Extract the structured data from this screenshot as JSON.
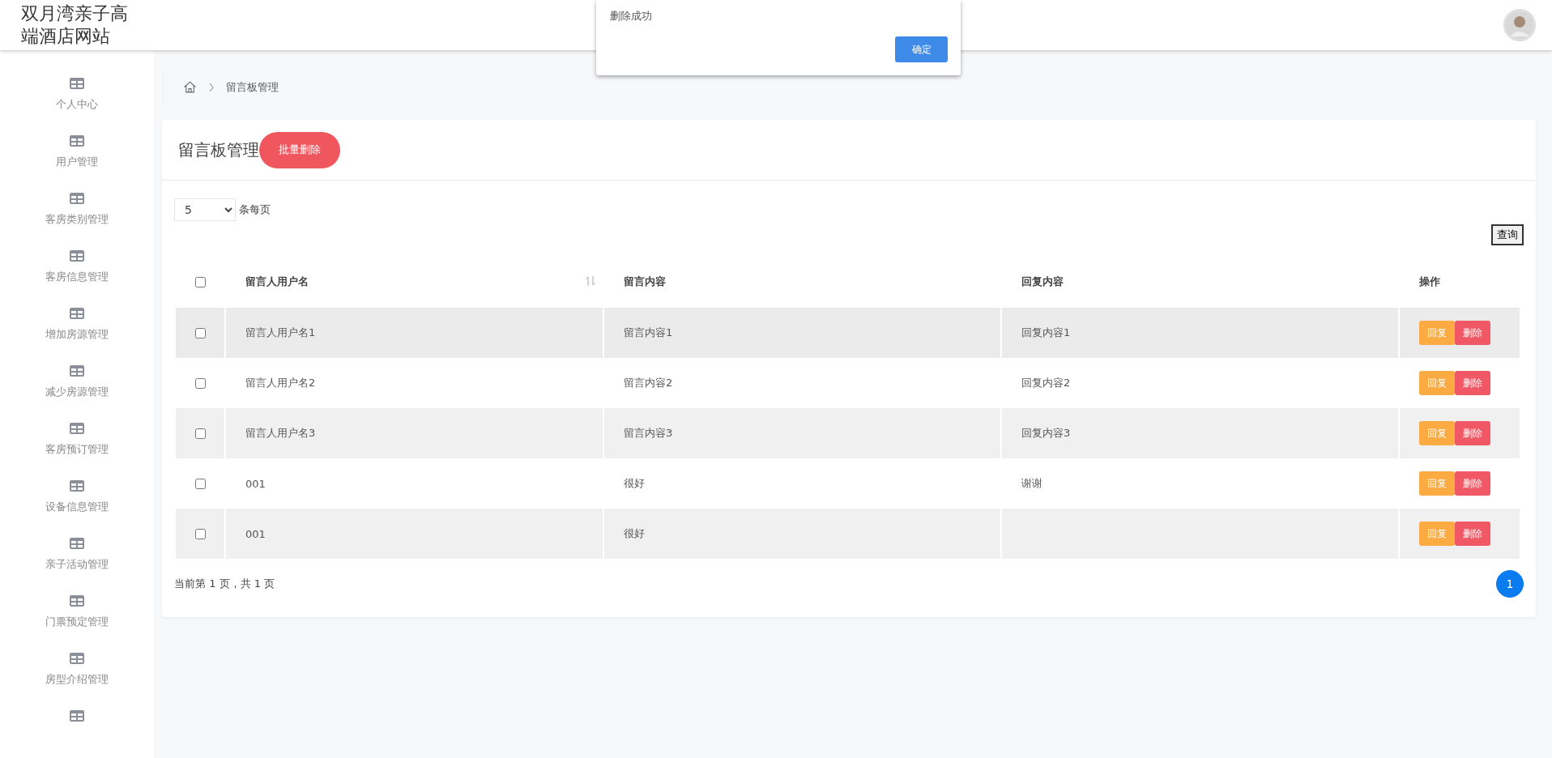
{
  "header": {
    "title": "双月湾亲子高端酒店网站"
  },
  "sidebar": {
    "items": [
      {
        "label": "个人中心"
      },
      {
        "label": "用户管理"
      },
      {
        "label": "客房类别管理"
      },
      {
        "label": "客房信息管理"
      },
      {
        "label": "增加房源管理"
      },
      {
        "label": "减少房源管理"
      },
      {
        "label": "客房预订管理"
      },
      {
        "label": "设备信息管理"
      },
      {
        "label": "亲子活动管理"
      },
      {
        "label": "门票预定管理"
      },
      {
        "label": "房型介绍管理"
      }
    ]
  },
  "breadcrumb": {
    "current": "留言板管理"
  },
  "card": {
    "title": "留言板管理",
    "batch_delete": "批量删除"
  },
  "page_size": {
    "value": "5",
    "label": "条每页"
  },
  "search_button": "查询",
  "table": {
    "select_all_checked": false,
    "columns": [
      "留言人用户名",
      "留言内容",
      "回复内容",
      "操作"
    ],
    "rows": [
      {
        "checked": false,
        "name": "留言人用户名1",
        "content": "留言内容1",
        "reply": "回复内容1",
        "actions": [
          "回复",
          "删除"
        ]
      },
      {
        "checked": false,
        "name": "留言人用户名2",
        "content": "留言内容2",
        "reply": "回复内容2",
        "actions": [
          "回复",
          "删除"
        ]
      },
      {
        "checked": false,
        "name": "留言人用户名3",
        "content": "留言内容3",
        "reply": "回复内容3",
        "actions": [
          "回复",
          "删除"
        ]
      },
      {
        "checked": false,
        "name": "001",
        "content": "很好",
        "reply": "谢谢",
        "actions": [
          "回复",
          "删除"
        ]
      },
      {
        "checked": false,
        "name": "001",
        "content": "很好",
        "actions": [
          "回复",
          "删除"
        ]
      }
    ]
  },
  "pagination": {
    "summary": "当前第 1 页，共 1 页",
    "pages": [
      {
        "label": "1",
        "selected": true
      }
    ]
  },
  "dialog": {
    "message": "删除成功",
    "confirm": "确定"
  }
}
